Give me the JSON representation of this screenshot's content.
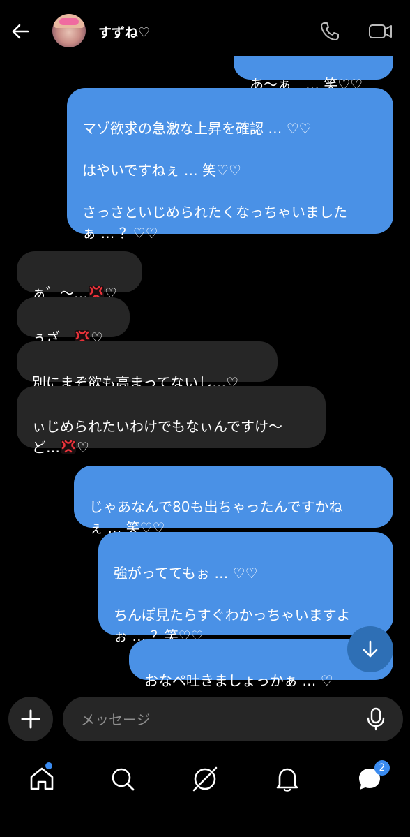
{
  "header": {
    "title": "すずね♡"
  },
  "messages": [
    {
      "side": "out",
      "text": "あ〜ぁ　… 笑♡♡"
    },
    {
      "side": "out",
      "text": "マゾ欲求の急激な上昇を確認 … ♡♡\n\nはやいですねぇ … 笑♡♡\n\nさっさといじめられたくなっちゃいました\nぁ … ？♡♡"
    },
    {
      "side": "in",
      "text": "ぁ゛〜…",
      "suffix": "♡"
    },
    {
      "side": "in",
      "text": "ぅざ…",
      "suffix": "♡"
    },
    {
      "side": "in",
      "text": "別にまぞ欲も高まってないし…♡"
    },
    {
      "side": "in",
      "text": "ぃじめられたいわけでもなぃんですけ〜\nど…",
      "suffix": "♡"
    },
    {
      "side": "out",
      "text": "じゃあなんで80も出ちゃったんですかね\nぇ … 笑♡♡"
    },
    {
      "side": "out",
      "text": "強がっててもぉ … ♡♡\n\nちんぽ見たらすぐわかっちゃいますよ\nぉ … ？笑♡♡"
    },
    {
      "side": "out",
      "text": "おなペ吐きましょっかぁ … ♡"
    }
  ],
  "composer": {
    "placeholder": "メッセージ"
  },
  "nav": {
    "messages_badge": "2"
  },
  "colors": {
    "outgoing_bubble": "#4a91e6",
    "incoming_bubble": "#262626",
    "accent": "#3a8bf0",
    "background": "#000000"
  },
  "icons": [
    "back-arrow-icon",
    "avatar",
    "phone-icon",
    "video-icon",
    "anger-emoji",
    "scroll-down-icon",
    "plus-icon",
    "mic-icon",
    "home-icon",
    "search-icon",
    "explore-icon",
    "bell-icon",
    "messages-icon"
  ]
}
